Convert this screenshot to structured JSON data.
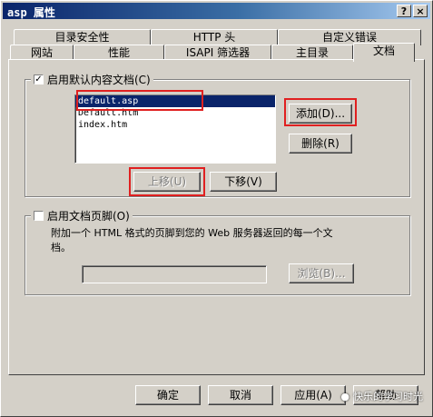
{
  "window": {
    "title": "asp 属性",
    "help_glyph": "?",
    "close_glyph": "×"
  },
  "tabs_back": [
    "目录安全性",
    "HTTP 头",
    "自定义错误"
  ],
  "tabs_front": [
    "网站",
    "性能",
    "ISAPI 筛选器",
    "主目录",
    "文档"
  ],
  "active_tab": "文档",
  "default_doc": {
    "checkbox_label": "启用默认内容文档(C)",
    "checked": true,
    "items": [
      "default.asp",
      "Default.htm",
      "index.htm"
    ],
    "selected_index": 0,
    "add_label": "添加(D)...",
    "remove_label": "删除(R)",
    "move_up_label": "上移(U)",
    "move_down_label": "下移(V)"
  },
  "footer_doc": {
    "checkbox_label": "启用文档页脚(O)",
    "checked": false,
    "description_line1": "附加一个 HTML 格式的页脚到您的 Web 服务器返回的每一个文",
    "description_line2": "档。",
    "path_value": "",
    "browse_label": "浏览(B)..."
  },
  "buttons": {
    "ok": "确定",
    "cancel": "取消",
    "apply": "应用(A)",
    "help": "帮助"
  },
  "watermark_text": "快乐的学习时光"
}
